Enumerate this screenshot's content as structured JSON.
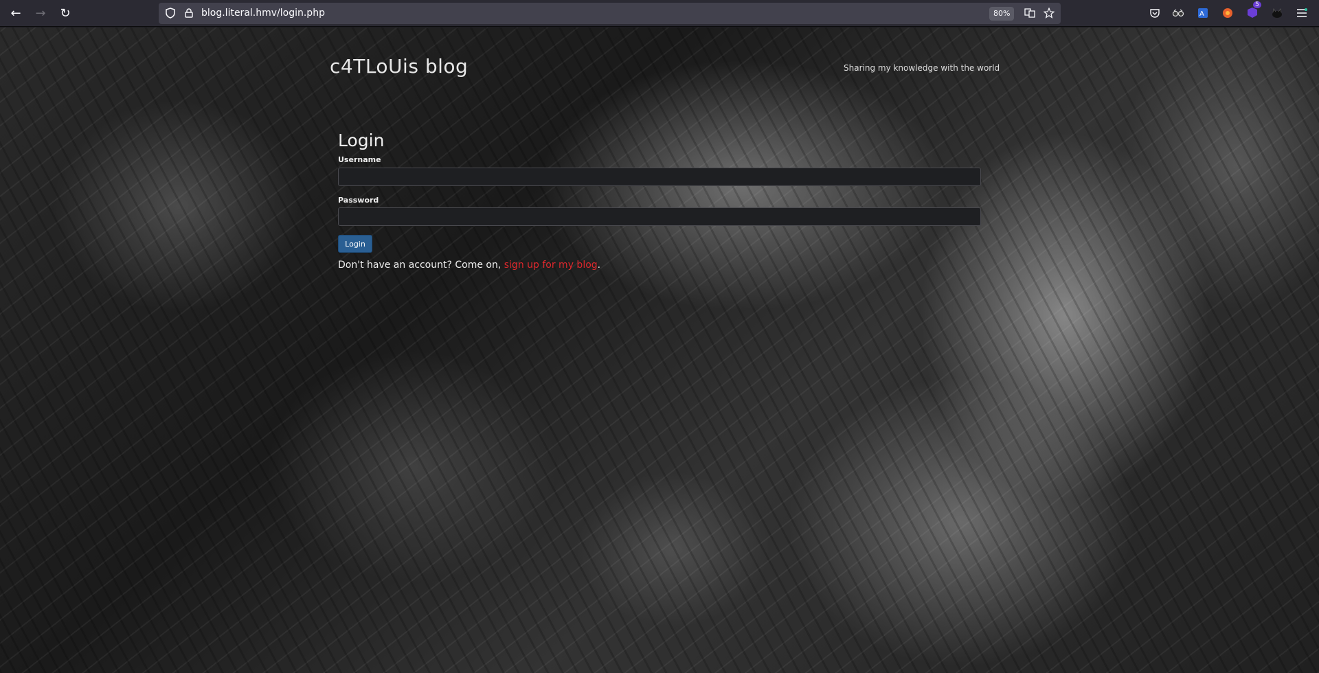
{
  "browser": {
    "url": "blog.literal.hmv/login.php",
    "zoom": "80%",
    "nav": {
      "back_icon": "←",
      "forward_icon": "→",
      "reload_icon": "↻"
    },
    "extension_badge": "5"
  },
  "site": {
    "title": "c4TLoUis blog",
    "tagline": "Sharing my knowledge with the world"
  },
  "login": {
    "heading": "Login",
    "username_label": "Username",
    "username_value": "",
    "password_label": "Password",
    "password_value": "",
    "submit_label": "Login",
    "signup_prefix": "Don't have an account? Come on, ",
    "signup_link": "sign up for my blog",
    "signup_suffix": "."
  },
  "colors": {
    "accent_link": "#e0282d",
    "button": "#2a5f93"
  }
}
